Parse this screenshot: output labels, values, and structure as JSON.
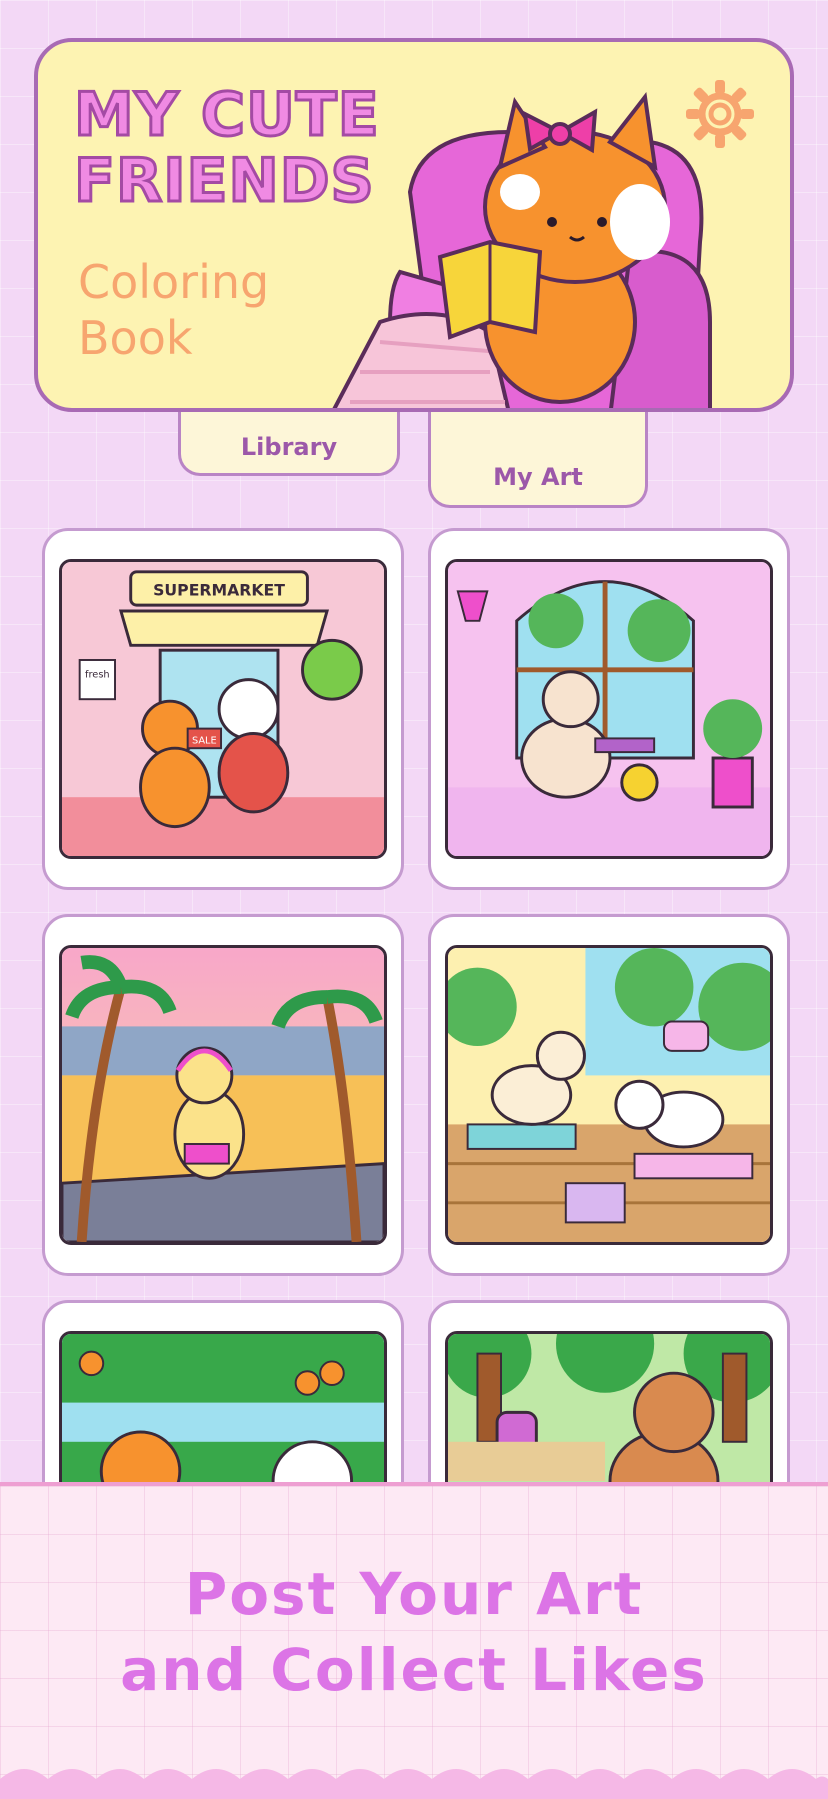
{
  "header": {
    "title": "MY CUTE\nFRIENDS",
    "subtitle": "Coloring\nBook",
    "settings_icon": "gear-icon"
  },
  "tabs": [
    {
      "label": "Library"
    },
    {
      "label": "My Art"
    }
  ],
  "gallery": {
    "items": [
      {
        "scene": "supermarket",
        "sign": "SUPERMARKET",
        "tag1": "fresh",
        "tag2": "SALE"
      },
      {
        "scene": "music-room"
      },
      {
        "scene": "beach"
      },
      {
        "scene": "yoga"
      },
      {
        "scene": "orchard"
      },
      {
        "scene": "park"
      }
    ]
  },
  "promo": {
    "text": "Post Your Art\nand Collect Likes"
  },
  "colors": {
    "background": "#f3d8f6",
    "header_bg": "#fdf3b2",
    "title": "#f08ae3",
    "subtitle": "#f7a56f",
    "promo_text": "#dc74e6"
  }
}
